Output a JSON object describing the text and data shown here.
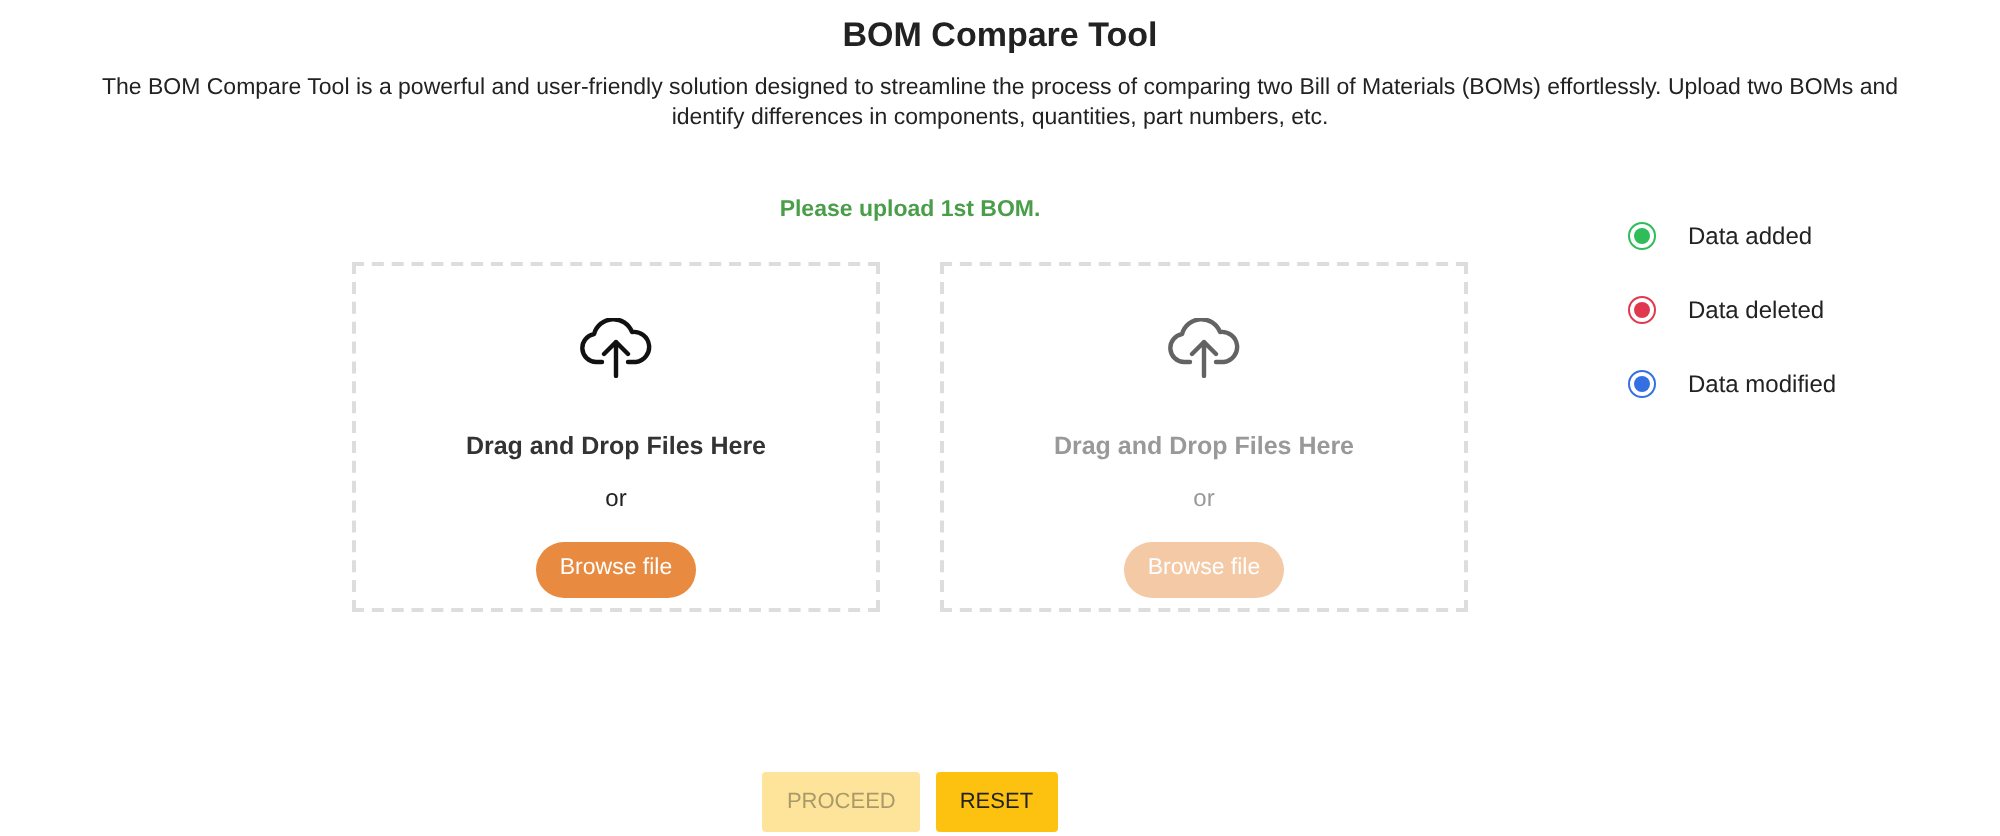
{
  "title": "BOM Compare Tool",
  "description": "The BOM Compare Tool is a powerful and user-friendly solution designed to streamline the process of comparing two Bill of Materials (BOMs) effortlessly. Upload two BOMs and identify differences in components, quantities, part numbers, etc.",
  "status_message": "Please upload 1st BOM.",
  "upload_boxes": [
    {
      "label": "Drag and Drop Files Here",
      "separator": "or",
      "button": "Browse file",
      "disabled": false
    },
    {
      "label": "Drag and Drop Files Here",
      "separator": "or",
      "button": "Browse file",
      "disabled": true
    }
  ],
  "legend": [
    {
      "label": "Data added",
      "color": "#2ebd59"
    },
    {
      "label": "Data deleted",
      "color": "#e0394f"
    },
    {
      "label": "Data modified",
      "color": "#3470e4"
    }
  ],
  "buttons": [
    {
      "label": "PROCEED",
      "disabled": true
    },
    {
      "label": "RESET",
      "disabled": false
    }
  ]
}
